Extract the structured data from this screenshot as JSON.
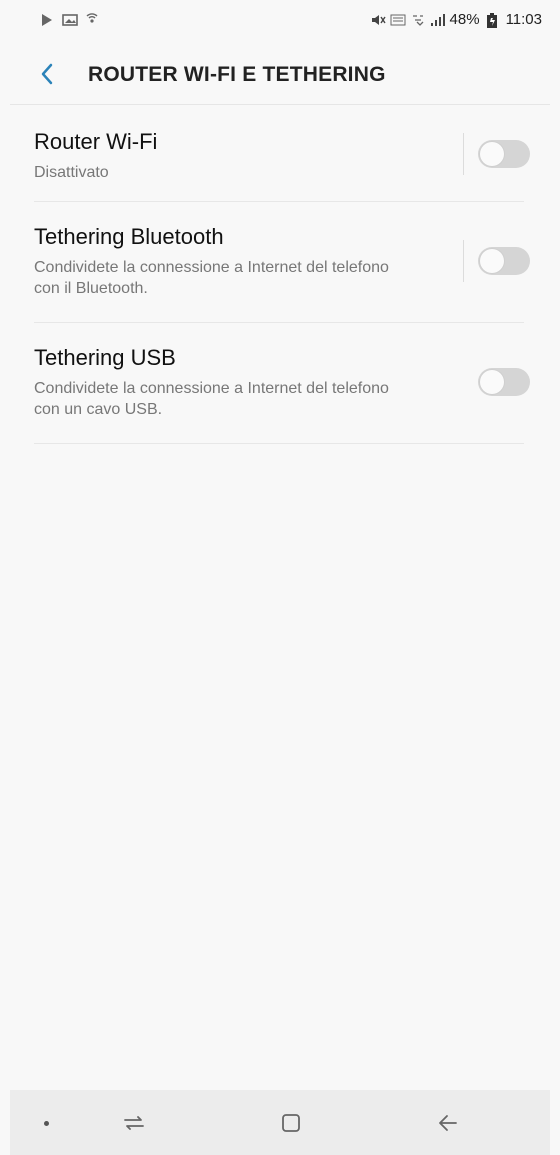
{
  "status_bar": {
    "battery_percent": "48%",
    "time": "11:03"
  },
  "app_bar": {
    "title": "ROUTER WI-FI E TETHERING"
  },
  "settings": [
    {
      "title": "Router Wi-Fi",
      "subtitle": "Disattivato",
      "enabled": false
    },
    {
      "title": "Tethering Bluetooth",
      "subtitle": "Condividete la connessione a Internet del telefono con il Bluetooth.",
      "enabled": false
    },
    {
      "title": "Tethering USB",
      "subtitle": "Condividete la connessione a Internet del telefono con un cavo USB.",
      "enabled": false
    }
  ],
  "colors": {
    "accent": "#2b83b9",
    "switch_off": "#d5d5d5"
  }
}
